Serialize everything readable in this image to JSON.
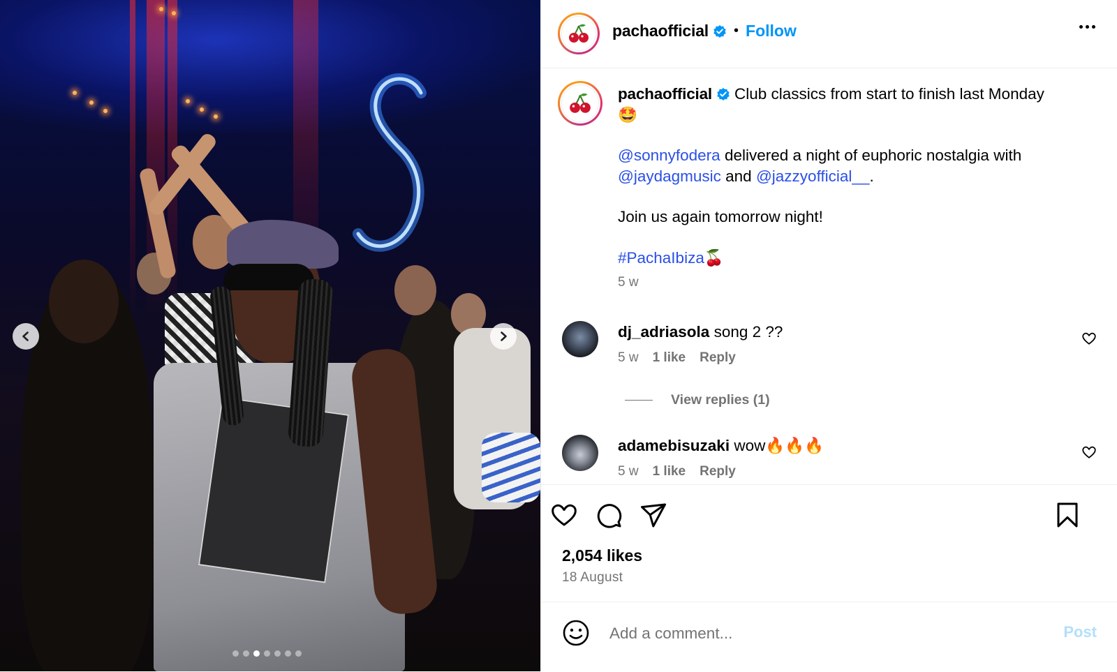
{
  "post": {
    "author": "pachaofficial",
    "follow_label": "Follow",
    "separator": "•",
    "caption": {
      "author": "pachaofficial",
      "line1": "Club classics from start to finish last Monday",
      "line1_emoji": "🤩",
      "mention1": "@sonnyfodera",
      "text2": " delivered a night of euphoric nostalgia with",
      "mention2": "@jaydagmusic",
      "text3": " and ",
      "mention3": "@jazzyofficial__",
      "text4": ".",
      "line3": "Join us again tomorrow night!",
      "hashtag": "#PachaIbiza",
      "hashtag_emoji": "🍒",
      "time": "5 w"
    },
    "comments": [
      {
        "user": "dj_adriasola",
        "text": " song 2 ??",
        "time": "5 w",
        "likes": "1 like",
        "reply": "Reply"
      },
      {
        "user": "adamebisuzaki",
        "text": " wow🔥🔥🔥",
        "time": "5 w",
        "likes": "1 like",
        "reply": "Reply"
      }
    ],
    "view_replies": "View replies (1)",
    "likes": "2,054 likes",
    "date": "18 August",
    "add_comment_placeholder": "Add a comment...",
    "post_label": "Post"
  },
  "carousel": {
    "count": 7,
    "active_index": 2
  },
  "icons": {
    "more": "more-options-icon",
    "like": "heart-icon",
    "comment": "comment-icon",
    "share": "send-icon",
    "save": "bookmark-icon",
    "emoji": "emoji-icon",
    "prev": "chevron-left-icon",
    "next": "chevron-right-icon"
  },
  "colors": {
    "link": "#0095f6",
    "mention": "#2a4fe6",
    "muted": "#737373",
    "post_disabled": "#b2dffc"
  }
}
